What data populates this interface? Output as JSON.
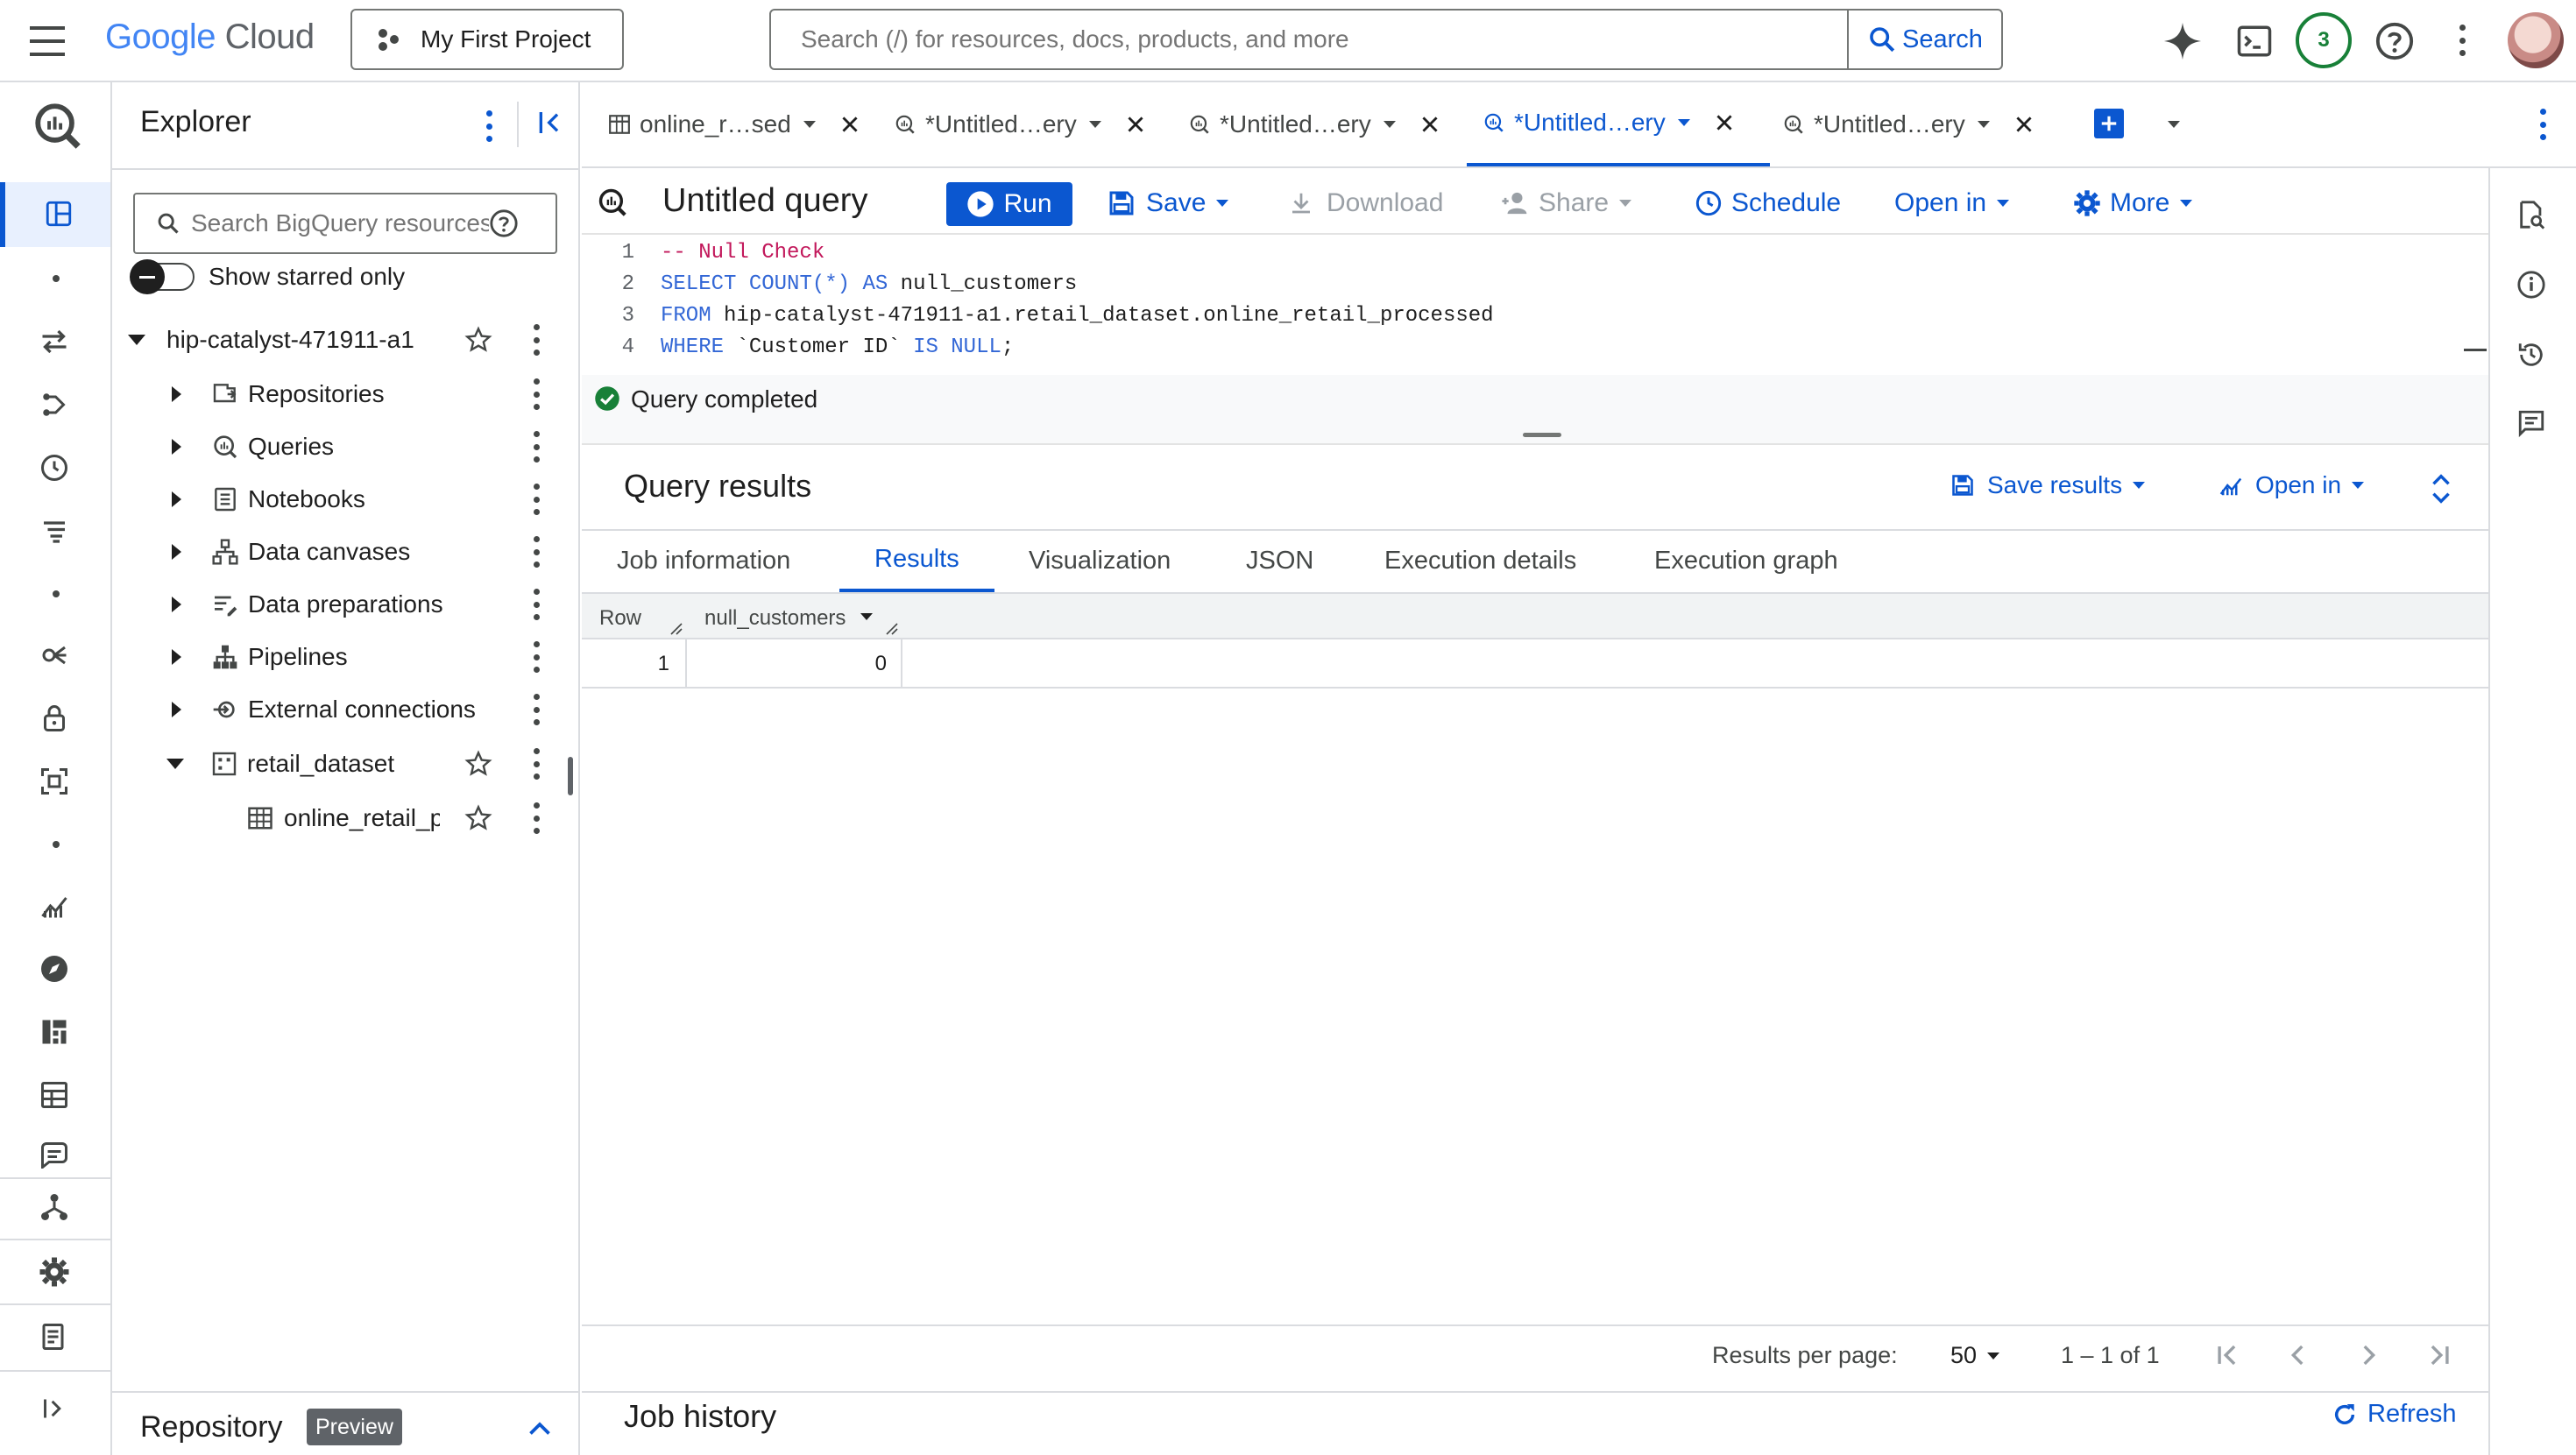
{
  "brand": {
    "google": "Google",
    "cloud": "Cloud"
  },
  "project": {
    "label": "My First Project"
  },
  "search": {
    "placeholder": "Search (/) for resources, docs, products, and more",
    "button": "Search"
  },
  "notifications": {
    "count": "3"
  },
  "explorer": {
    "title": "Explorer",
    "search_placeholder": "Search BigQuery resources",
    "starred_toggle": "Show starred only",
    "project_id": "hip-catalyst-471911-a1",
    "items": [
      {
        "label": "Repositories",
        "icon": "repositories-icon"
      },
      {
        "label": "Queries",
        "icon": "queries-icon"
      },
      {
        "label": "Notebooks",
        "icon": "notebooks-icon"
      },
      {
        "label": "Data canvases",
        "icon": "data-canvases-icon"
      },
      {
        "label": "Data preparations",
        "icon": "data-preparations-icon"
      },
      {
        "label": "Pipelines",
        "icon": "pipelines-icon"
      },
      {
        "label": "External connections",
        "icon": "external-connections-icon"
      }
    ],
    "dataset": "retail_dataset",
    "table": "online_retail_p",
    "repository_title": "Repository",
    "repository_badge": "Preview"
  },
  "tabs": [
    {
      "label": "online_r…sed",
      "type": "table"
    },
    {
      "label": "*Untitled…ery",
      "type": "query"
    },
    {
      "label": "*Untitled…ery",
      "type": "query"
    },
    {
      "label": "*Untitled…ery",
      "type": "query",
      "active": true
    },
    {
      "label": "*Untitled…ery",
      "type": "query"
    }
  ],
  "toolbar": {
    "title": "Untitled query",
    "run": "Run",
    "save": "Save",
    "download": "Download",
    "share": "Share",
    "schedule": "Schedule",
    "open_in": "Open in",
    "more": "More"
  },
  "editor": {
    "lines": [
      {
        "num": "1",
        "comment": "-- Null Check"
      },
      {
        "num": "2",
        "kw1": "SELECT",
        "fn": "COUNT(*)",
        "kw2": "AS",
        "rest": "null_customers"
      },
      {
        "num": "3",
        "kw1": "FROM",
        "rest": "hip-catalyst-471911-a1.retail_dataset.online_retail_processed"
      },
      {
        "num": "4",
        "kw1": "WHERE",
        "ident": "`Customer ID`",
        "kw2": "IS NULL",
        "end": ";"
      }
    ],
    "status": "Query completed"
  },
  "results": {
    "title": "Query results",
    "save_results": "Save results",
    "open_in": "Open in",
    "tabs": [
      "Job information",
      "Results",
      "Visualization",
      "JSON",
      "Execution details",
      "Execution graph"
    ],
    "active_tab": "Results",
    "columns": [
      "Row",
      "null_customers"
    ],
    "rows": [
      [
        "1",
        "0"
      ]
    ],
    "per_page_label": "Results per page:",
    "per_page_value": "50",
    "range": "1 – 1 of 1"
  },
  "job_history": {
    "title": "Job history",
    "refresh": "Refresh"
  },
  "colors": {
    "accent": "#0b57d0",
    "run_bg": "#0b57d0",
    "success": "#188038",
    "badge_bg": "#5f6368"
  }
}
